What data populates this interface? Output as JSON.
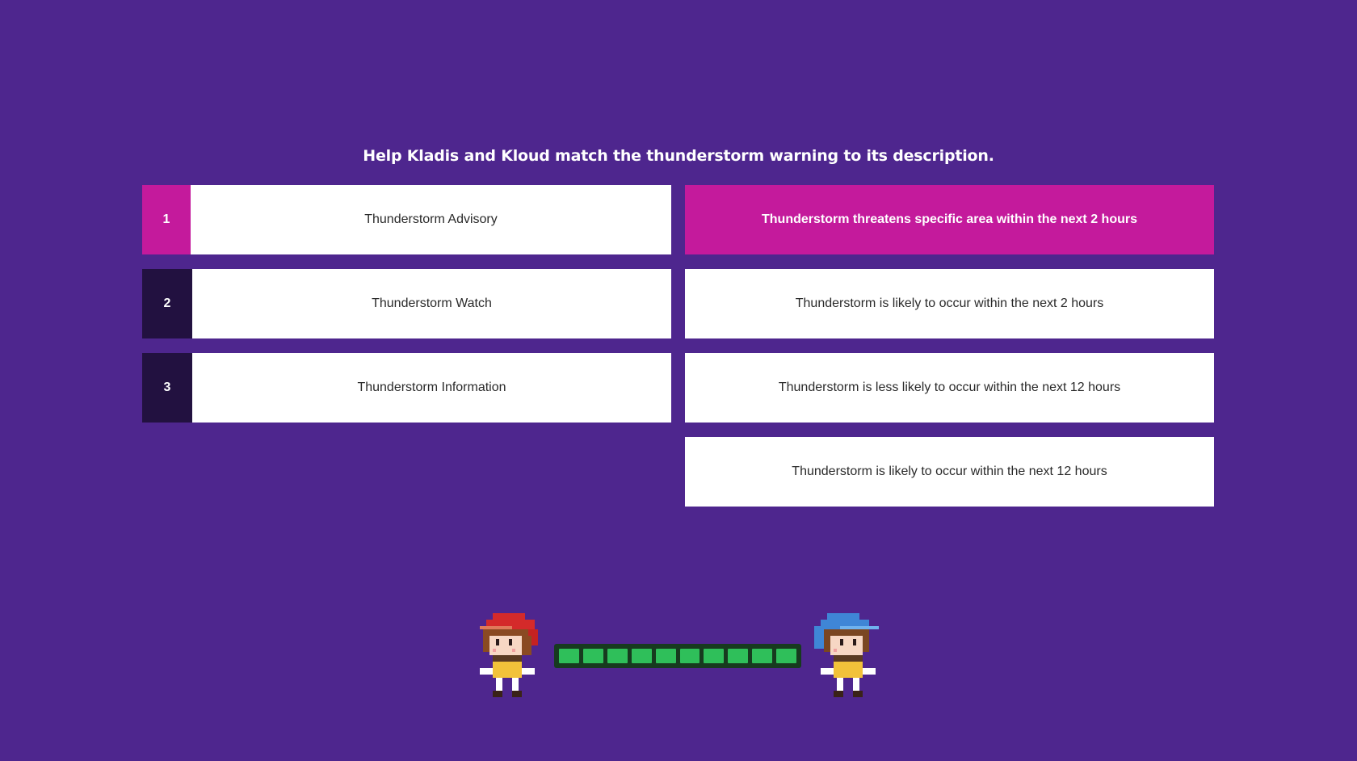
{
  "instruction": "Help Kladis and Kloud match the thunderstorm warning to its description.",
  "terms": [
    {
      "number": "1",
      "label": "Thunderstorm Advisory",
      "active": true
    },
    {
      "number": "2",
      "label": "Thunderstorm Watch",
      "active": false
    },
    {
      "number": "3",
      "label": "Thunderstorm Information",
      "active": false
    }
  ],
  "descriptions": [
    {
      "text": "Thunderstorm threatens specific area within the next 2 hours",
      "selected": true
    },
    {
      "text": "Thunderstorm is likely to occur within the next 2 hours",
      "selected": false
    },
    {
      "text": "Thunderstorm is less likely to occur within the next 12 hours",
      "selected": false
    },
    {
      "text": "Thunderstorm is likely to occur within the next 12 hours",
      "selected": false
    }
  ],
  "progress": {
    "filled_segments": 10,
    "total_segments": 10
  },
  "characters": [
    {
      "name": "Kladis",
      "icon": "pixel-girl-red-hat-icon"
    },
    {
      "name": "Kloud",
      "icon": "pixel-boy-blue-hat-icon"
    }
  ],
  "colors": {
    "background": "#4e268e",
    "accent": "#c41a9c",
    "number_tab": "#221140",
    "progress_fill": "#2fbf5a"
  }
}
